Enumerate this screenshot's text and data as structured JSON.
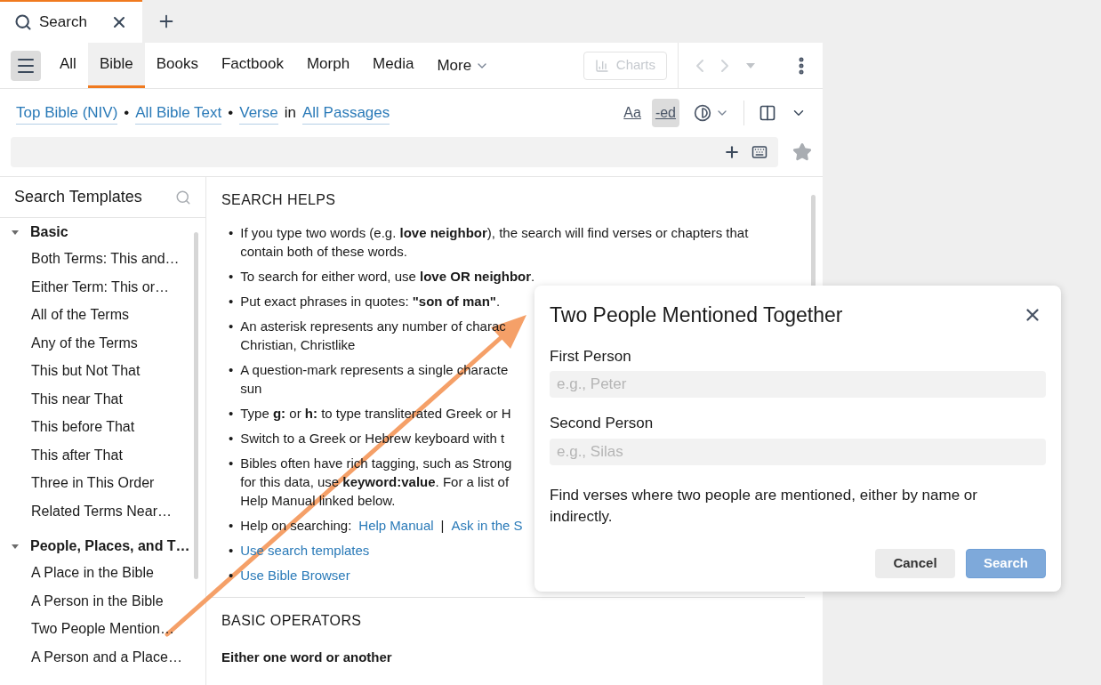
{
  "doc_tabs": [
    {
      "label": "Search",
      "selected": true
    }
  ],
  "toolbar": {
    "tabs": [
      {
        "label": "All",
        "selected": false
      },
      {
        "label": "Bible",
        "selected": true
      },
      {
        "label": "Books",
        "selected": false
      },
      {
        "label": "Factbook",
        "selected": false
      },
      {
        "label": "Morph",
        "selected": false
      },
      {
        "label": "Media",
        "selected": false
      }
    ],
    "more": "More",
    "charts": {
      "label": "Charts",
      "disabled": true
    }
  },
  "scope": [
    {
      "kind": "link",
      "text": "Top Bible (NIV)"
    },
    {
      "kind": "sep",
      "text": "•"
    },
    {
      "kind": "link",
      "text": "All Bible Text"
    },
    {
      "kind": "sep",
      "text": "•"
    },
    {
      "kind": "link",
      "text": "Verse"
    },
    {
      "kind": "sep",
      "text": "in"
    },
    {
      "kind": "link",
      "text": "All Passages"
    }
  ],
  "view_buttons": [
    {
      "label": "Aa",
      "active": false
    },
    {
      "label": "-ed",
      "active": true
    }
  ],
  "sidebar": {
    "title": "Search Templates",
    "groups": [
      {
        "label": "Basic",
        "expanded": true,
        "items": [
          "Both Terms: This and…",
          "Either Term: This or…",
          "All of the Terms",
          "Any of the Terms",
          "This but Not That",
          "This near That",
          "This before That",
          "This after That",
          "Three in This Order",
          "Related Terms Near…"
        ]
      },
      {
        "label": "People, Places, and T…",
        "expanded": true,
        "items": [
          "A Place in the Bible",
          "A Person in the Bible",
          "Two People Mention…",
          "A Person and a Place…"
        ]
      }
    ]
  },
  "helps": {
    "title": "SEARCH HELPS",
    "bullet": "•",
    "items": [
      {
        "kind": "text",
        "lines": [
          "If you type two words (e.g. **love neighbor**), the search will find verses or chapters that",
          "contain both of these words."
        ]
      },
      {
        "kind": "text",
        "lines": [
          "To search for either word, use **love OR neighbor**."
        ]
      },
      {
        "kind": "text",
        "lines": [
          "Put exact phrases in quotes: **\"son of man\"**."
        ]
      },
      {
        "kind": "text",
        "lines": [
          "An asterisk represents any number of charac",
          "Christian, Christlike"
        ]
      },
      {
        "kind": "text",
        "lines": [
          "A question-mark represents a single characte",
          "sun"
        ]
      },
      {
        "kind": "text",
        "lines": [
          "Type **g:** or **h:** to type transliterated Greek or H"
        ]
      },
      {
        "kind": "text",
        "lines": [
          "Switch to a Greek or Hebrew keyboard with t"
        ]
      },
      {
        "kind": "text",
        "lines": [
          "Bibles often have rich tagging, such as Strong",
          "for this data, use **keyword:value**. For a list of",
          "Help Manual linked below."
        ]
      },
      {
        "kind": "links",
        "prefix": "Help on searching:",
        "links": [
          "Help Manual",
          "Ask in the S"
        ],
        "sep": "|"
      },
      {
        "kind": "link",
        "text": "Use search templates"
      },
      {
        "kind": "link",
        "text": "Use Bible Browser"
      }
    ]
  },
  "operators": {
    "title": "BASIC OPERATORS",
    "subtitle": "Either one word or another"
  },
  "dialog": {
    "title": "Two People Mentioned Together",
    "fields": [
      {
        "label": "First Person",
        "placeholder": "e.g., Peter"
      },
      {
        "label": "Second Person",
        "placeholder": "e.g., Silas"
      }
    ],
    "description": "Find verses where two people are mentioned, either by name or indirectly.",
    "buttons": [
      {
        "label": "Cancel",
        "kind": "secondary",
        "disabled": false
      },
      {
        "label": "Search",
        "kind": "primary",
        "disabled": true
      }
    ]
  }
}
